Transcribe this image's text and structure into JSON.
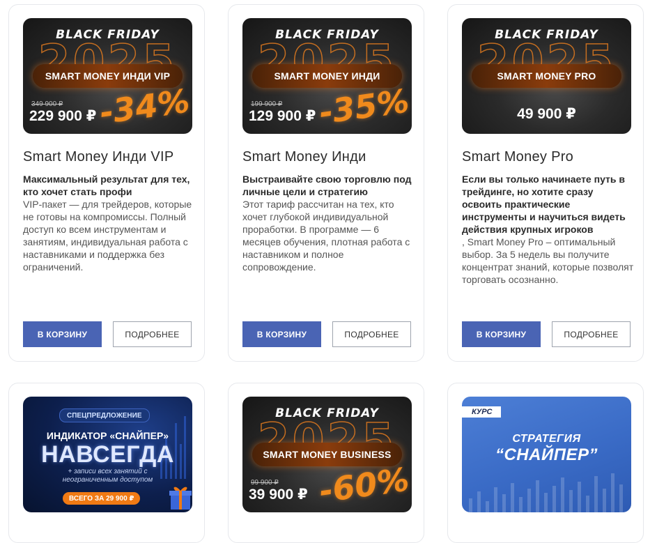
{
  "buttons": {
    "cart": "В КОРЗИНУ",
    "more": "ПОДРОБНЕЕ"
  },
  "banner_heading": "BLACK FRIDAY",
  "banner_year": "2025",
  "products": [
    {
      "banner_pill": "SMART MONEY ИНДИ VIP",
      "old_price": "349 900 ₽",
      "price": "229 900 ₽",
      "discount": "-34%",
      "title": "Smart Money Инди VIP",
      "lead": "Максимальный результат для тех, кто хочет стать профи",
      "body": "VIP-пакет — для трейдеров, которые не готовы на компромиссы. Полный доступ ко всем инструментам и занятиям, индивидуальная работа с наставниками и поддержка без ограничений."
    },
    {
      "banner_pill": "SMART MONEY ИНДИ",
      "old_price": "199 900 ₽",
      "price": "129 900 ₽",
      "discount": "-35%",
      "title": "Smart Money Инди",
      "lead": "Выстраивайте свою торговлю под личные цели и стратегию",
      "body": "Этот тариф рассчитан на тех, кто хочет глубокой индивидуальной проработки. В программе — 6 месяцев обучения, плотная работа с наставником и полное сопровождение."
    },
    {
      "banner_pill": "SMART MONEY PRO",
      "price": "49 900 ₽",
      "title": "Smart Money Pro",
      "lead": "Если вы только начинаете путь в трейдинге, но хотите сразу освоить практические инструменты и научиться видеть действия крупных игроков",
      "body": ", Smart Money Pro – оптимальный выбор. За 5 недель вы получите концентрат знаний, которые позволят торговать осознанно."
    }
  ],
  "row2": {
    "indicator": {
      "tag": "СПЕЦПРЕДЛОЖЕНИЕ",
      "line1": "ИНДИКАТОР «СНАЙПЕР»",
      "line2": "НАВСЕГДА",
      "note": "+ записи всех занятий с неограниченным доступом",
      "price": "ВСЕГО ЗА 29 900 ₽"
    },
    "business": {
      "banner_pill": "SMART MONEY BUSINESS",
      "old_price": "99 900 ₽",
      "price": "39 900 ₽",
      "discount": "-60%"
    },
    "course": {
      "tag": "КУРС",
      "line1": "СТРАТЕГИЯ",
      "line2": "“СНАЙПЕР”"
    }
  },
  "colors": {
    "cart_button": "#4a64b4",
    "discount_orange": "#f08a1c",
    "course_blue": "#3a6bc6"
  }
}
